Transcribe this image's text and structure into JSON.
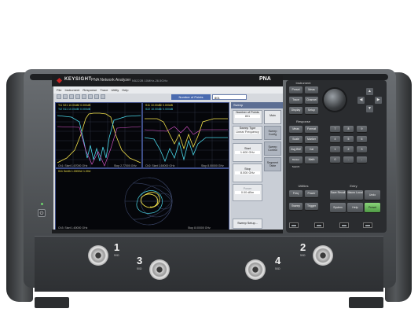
{
  "header": {
    "brand": "KEYSIGHT",
    "product": "PNA Network Analyzer",
    "model": "N5222B 10MHz-26.5GHz",
    "family": "PNA"
  },
  "screen": {
    "menu": [
      "File",
      "Instrument",
      "Response",
      "Trace",
      "Utility",
      "Help"
    ],
    "number_of_points_label": "Number of Points",
    "number_of_points_value": "801",
    "pane1": {
      "trace_label": "Tr1 S21 10.00dB/ 0.000dB",
      "trace_label2": "Tr2 S11 10.00dB/ 0.000dB",
      "stim_start": "Ch1: Start 1.67000 GHz",
      "stim_stop": "Stop 2.77000 GHz"
    },
    "pane2": {
      "trace_label": "S11 10.00dB/ 0.000dB",
      "trace_label2": "S22 10.00dB/ 0.000dB",
      "stim_start": "Ch2: Start 1.60000 GHz",
      "stim_stop": "Stop 8.00000 GHz"
    },
    "pane3": {
      "trace_label": "S11 Smith 1.0000U/ 1.00U",
      "stim_start": "Ch3: Start 1.60000 GHz",
      "stim_stop": "Stop 8.00000 GHz"
    },
    "softkeys": {
      "title": "Sweep",
      "items": [
        {
          "label": "Number of Points",
          "value": "801"
        },
        {
          "label": "Sweep Type",
          "value": "Linear Frequency"
        },
        {
          "label": "Start",
          "value": "1.600 GHz"
        },
        {
          "label": "Stop",
          "value": "8.000 GHz"
        },
        {
          "label": "Power",
          "value": "0.00 dBm"
        },
        {
          "label": "Sweep Setup...",
          "value": ""
        }
      ],
      "tabs": [
        "Main",
        "Sweep Config",
        "Sweep Control",
        "Segment Table"
      ]
    }
  },
  "panel": {
    "groups": [
      "Instrument",
      "Response",
      "Utilities",
      "Entry"
    ],
    "instrument_keys": [
      "Preset",
      "Meas",
      "Trace",
      "Channel",
      "Display",
      "Setup"
    ],
    "response_keys": [
      "Meas",
      "Format",
      "Scale",
      "Marker",
      "Avg BW",
      "Cal",
      "Marker Search",
      "Math"
    ],
    "utility_keys": [
      "Freq",
      "Power",
      "Sweep",
      "Trigger"
    ],
    "entry_keys": [
      "Save Recall",
      "Macro Local",
      "Undo",
      "System",
      "Help",
      "Preset"
    ],
    "numpad": [
      "7",
      "8",
      "9",
      "4",
      "5",
      "6",
      "1",
      "2",
      "3",
      "0",
      ".",
      "-"
    ],
    "arrows": [
      "▲",
      "◀",
      "▶",
      "▼"
    ]
  },
  "ports": [
    {
      "num": "1",
      "sub": "50Ω"
    },
    {
      "num": "3",
      "sub": "50Ω"
    },
    {
      "num": "4",
      "sub": "50Ω"
    },
    {
      "num": "2",
      "sub": "50Ω"
    }
  ],
  "colors": {
    "trace_yellow": "#f0e04a",
    "trace_cyan": "#4ad6e8",
    "trace_magenta": "#e45ad6",
    "brand_red": "#c92323",
    "preset_green": "#6dbf5c"
  }
}
